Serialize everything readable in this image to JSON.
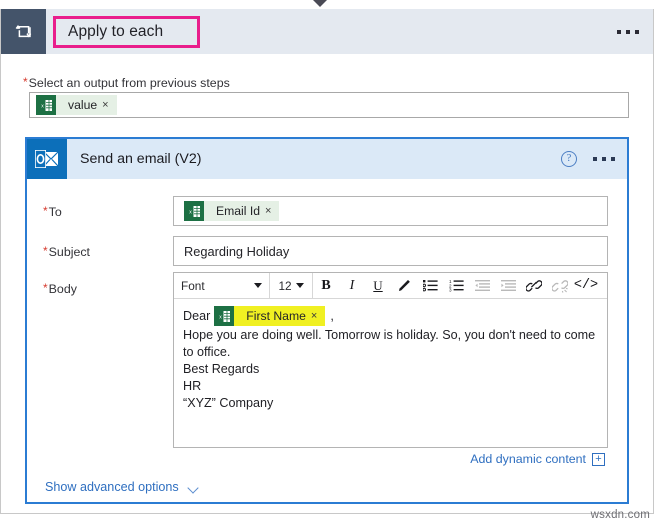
{
  "top_connector": {
    "icon": "chevron-down-icon"
  },
  "loop_card": {
    "icon": "loop-icon",
    "title": "Apply to each",
    "menu": "ellipsis-icon",
    "select_output": {
      "required_marker": "*",
      "label": "Select an output from previous steps",
      "token": {
        "icon": "excel-icon",
        "label": "value",
        "remove": "×"
      }
    }
  },
  "email_card": {
    "icon": "outlook-icon",
    "title": "Send an email (V2)",
    "help": "?",
    "menu": "ellipsis-icon",
    "fields": {
      "to": {
        "required_marker": "*",
        "label": "To",
        "token": {
          "icon": "excel-icon",
          "label": "Email Id",
          "remove": "×"
        }
      },
      "subject": {
        "required_marker": "*",
        "label": "Subject",
        "value": "Regarding Holiday"
      },
      "body": {
        "required_marker": "*",
        "label": "Body"
      }
    },
    "toolbar": {
      "font_label": "Font",
      "size_label": "12",
      "bold": "B",
      "italic": "I",
      "underline": "U",
      "text_color": "pen-icon",
      "bulleted_list": "bulleted-list-icon",
      "numbered_list": "numbered-list-icon",
      "indent_decrease": "indent-decrease-icon",
      "indent_increase": "indent-increase-icon",
      "link": "link-icon",
      "unlink": "unlink-icon",
      "code_view": "</>"
    },
    "body_content": {
      "greeting_prefix": "Dear",
      "greeting_token": {
        "icon": "excel-icon",
        "label": "First Name",
        "remove": "×",
        "highlighted": true
      },
      "greeting_suffix": ",",
      "paragraph": "Hope you are doing well. Tomorrow is holiday. So, you don't need to come to office.",
      "signoff": "Best Regards",
      "signer": "HR",
      "company": "“XYZ” Company"
    },
    "add_dynamic_content": {
      "label": "Add dynamic content",
      "plus": "+"
    },
    "show_advanced": {
      "label": "Show advanced options",
      "icon": "chevron-down-icon"
    }
  },
  "watermark": "wsxdn.com",
  "colors": {
    "loop_header_bg": "#e4e9f0",
    "loop_icon_bg": "#44546a",
    "highlight_pink": "#e91e8c",
    "email_header_bg": "#dbe9f7",
    "email_border": "#2b7cd3",
    "outlook_blue": "#0c6fba",
    "excel_green": "#1d7044",
    "token_bg": "#e5f0e5",
    "token_highlight": "#f0f022",
    "link_blue": "#2f6fc0",
    "required_red": "#d63b2f"
  }
}
